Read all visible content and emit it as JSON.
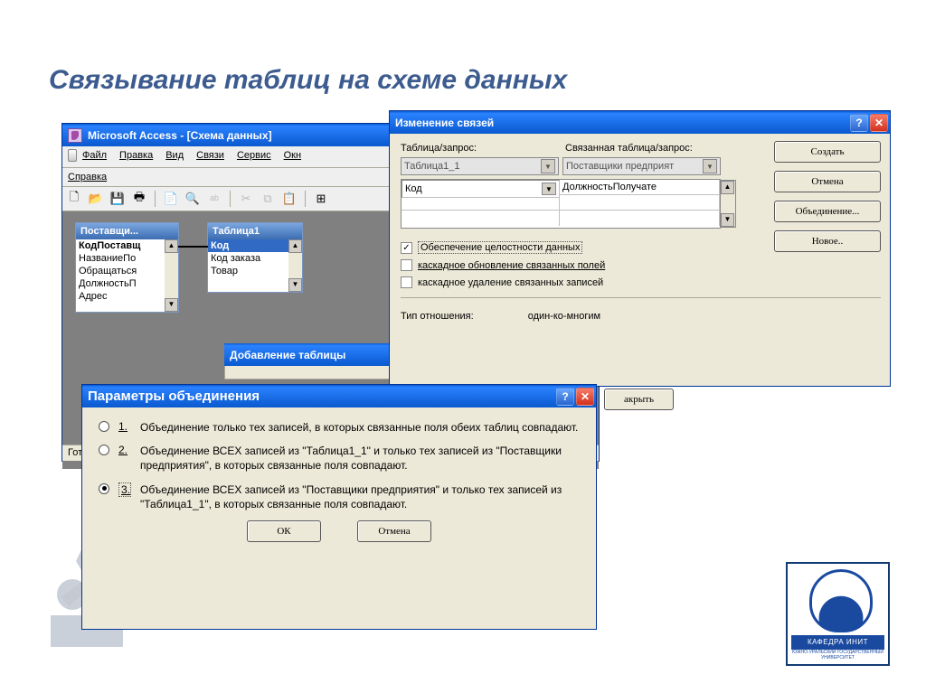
{
  "slide": {
    "title": "Связывание таблиц на схеме данных"
  },
  "access": {
    "title": "Microsoft Access - [Схема данных]",
    "menus": [
      "Файл",
      "Правка",
      "Вид",
      "Связи",
      "Сервис",
      "Окн"
    ],
    "help": "Справка",
    "status": "Гот",
    "box1": {
      "title": "Поставщи...",
      "rows": [
        "КодПоставщ",
        "НазваниеПо",
        "Обращаться",
        "ДолжностьП",
        "Адрес"
      ]
    },
    "box2": {
      "title": "Таблица1",
      "rows": [
        "Код",
        "Код заказа",
        "Товар"
      ]
    }
  },
  "addtable": {
    "title": "Добавление таблицы",
    "close": "акрыть"
  },
  "editrel": {
    "title": "Изменение связей",
    "col1": "Таблица/запрос:",
    "col2": "Связанная таблица/запрос:",
    "combo1": "Таблица1_1",
    "combo2": "Поставщики предприят",
    "field1": "Код",
    "field2": "ДолжностьПолучате",
    "integrity": "Обеспечение целостности данных",
    "cascade_update": "каскадное обновление связанных полей",
    "cascade_delete": "каскадное удаление связанных записей",
    "reltype_label": "Тип отношения:",
    "reltype_value": "один-ко-многим",
    "buttons": {
      "create": "Создать",
      "cancel": "Отмена",
      "join": "Объединение...",
      "new": "Новое.."
    }
  },
  "joinopts": {
    "title": "Параметры объединения",
    "opt1": "Объединение только тех записей, в которых связанные поля обеих таблиц совпадают.",
    "opt2": "Объединение ВСЕХ записей из \"Таблица1_1\" и только тех записей из \"Поставщики предприятия\", в которых связанные поля совпадают.",
    "opt3": "Объединение ВСЕХ записей из \"Поставщики предприятия\" и только тех записей из \"Таблица1_1\", в которых связанные поля совпадают.",
    "n1": "1.",
    "n2": "2.",
    "n3": "3.",
    "ok": "ОК",
    "cancel": "Отмена"
  },
  "logo": {
    "band": "КАФЕДРА ИНИТ",
    "sub": "ЮЖНО-УРАЛЬСКИЙ ГОСУДАРСТВЕННЫЙ УНИВЕРСИТЕТ"
  }
}
